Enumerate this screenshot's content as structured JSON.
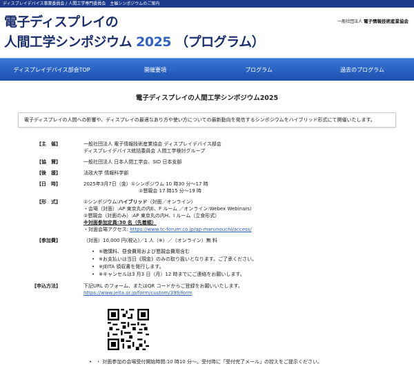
{
  "topbar": "ディスプレイデバイス事業委員会 / 人間工学専門委員会　主催シンポジウムのご案内",
  "header": {
    "title_line1": "電子ディスプレイの",
    "title_line2": "人間工学シンポジウム",
    "year": "2025",
    "program": "（プログラム）",
    "org_prefix": "一般社団法人",
    "org_name": "電子情報技術産業協会"
  },
  "nav": [
    {
      "label": "ディスプレイデバイス部会TOP"
    },
    {
      "label": "開催要項"
    },
    {
      "label": "プログラム"
    },
    {
      "label": "過去のプログラム"
    }
  ],
  "page_title": "電子ディスプレイの人間工学シンポジウム2025",
  "intro": "電子ディスプレイの人間への影響や、ディスプレイの最適なあり方や使い方についての最新動向を発信するシンポジウムをハイブリッド形式にて開催いたします。",
  "info": {
    "organizer_key": "【主　催】",
    "organizer_1": "一般社団法人 電子情報技術産業協会 ディスプレイデバイス部会",
    "organizer_2": "ディスプレイデバイス統括委員会 人間工学検討グループ",
    "cosponsor_key": "【協　賛】",
    "cosponsor": "一般社団法人 日本人間工学会、SID 日本支部",
    "support_key": "【後　援】",
    "support": "法政大学 情報科学部",
    "date_key": "【日　時】",
    "date_1": "2025年3月7日（金）①シンポジウム 10 時30 分～17 時",
    "date_2": "②懇親会 17 時15 分～19 時",
    "format_key": "【形　式】",
    "format_1a": "①シンポジウム:",
    "format_1b": "ハイブリッド",
    "format_1c": "（対面／オンライン）",
    "format_2": "・会場（対面）:AP 東京丸の内E、F ルーム ／オンライン:Webex Webinars）",
    "format_3": "②懇親会（対面のみ）:AP 東京丸の内H、I ルーム（立食形式）",
    "format_4": "※対面参加定員:30 名（先着順）",
    "format_5": "・対面会場アクセス:",
    "format_link": "https://www.tc-forum.co.jp/ap-marunouchi/access/",
    "fee_key": "【参加費】",
    "fee": "（対面）10,000 円(税込)／1 人（※）／（オンライン）無 料",
    "notes": [
      "※聴講料、昼食費用および懇親会費用含む",
      "※お支払いは当日《現金》のみの取り扱いとなります。ご了承ください。",
      "※JEITA 領収書を発行します。",
      "※キャンセルは3 月3 日（月）12 時までにご連絡をお願いします。"
    ],
    "apply_key": "【申込方法】",
    "apply": "下記URL のフォーム、またはQR コードからご登録をお願いいたします。",
    "apply_link": "https://www.jeita.or.jp/form/custom/399/form"
  },
  "bottom_notes": [
    "・ 対面参加の会場受付開始時間:10 時10 分～。受付時に「受付完了メール」の控えをご提示ください。"
  ]
}
